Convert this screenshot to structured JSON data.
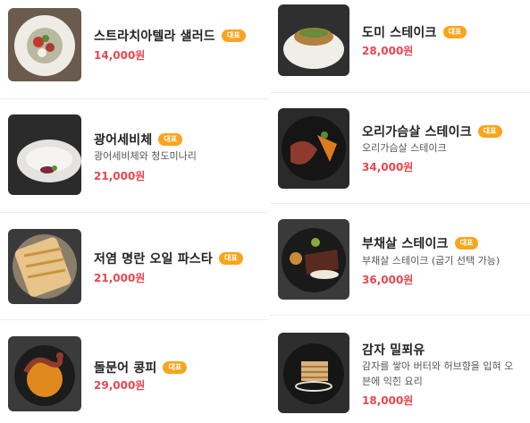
{
  "badge_label": "대표",
  "left": [
    {
      "name": "스트라치아텔라 샐러드",
      "desc": "",
      "price": "14,000원",
      "icon": "salad-plate-photo"
    },
    {
      "name": "광어세비체",
      "desc": "광어세비체와 청도미나리",
      "price": "21,000원",
      "icon": "ceviche-plate-photo"
    },
    {
      "name": "저염 명란 오일 파스타",
      "desc": "",
      "price": "21,000원",
      "icon": "pasta-plate-photo"
    },
    {
      "name": "돌문어 콩피",
      "desc": "",
      "price": "29,000원",
      "icon": "octopus-plate-photo"
    }
  ],
  "right": [
    {
      "name": "도미 스테이크",
      "desc": "",
      "price": "28,000원",
      "icon": "fish-steak-photo"
    },
    {
      "name": "오리가슴살 스테이크",
      "desc": "오리가슴살 스테이크",
      "price": "34,000원",
      "icon": "duck-steak-photo"
    },
    {
      "name": "부채살 스테이크",
      "desc": "부채살 스테이크 (굽기 선택 가능)",
      "price": "36,000원",
      "icon": "beef-steak-photo"
    },
    {
      "name": "감자 밀푀유",
      "desc_lines": [
        "감자를 쌓아 버터와 허브향을 입혀 오",
        "븐에 익힌 요리"
      ],
      "price": "18,000원",
      "icon": "potato-millefeuille-photo"
    }
  ],
  "colors": {
    "badge": "#f7a51c",
    "price": "#e8474f"
  }
}
